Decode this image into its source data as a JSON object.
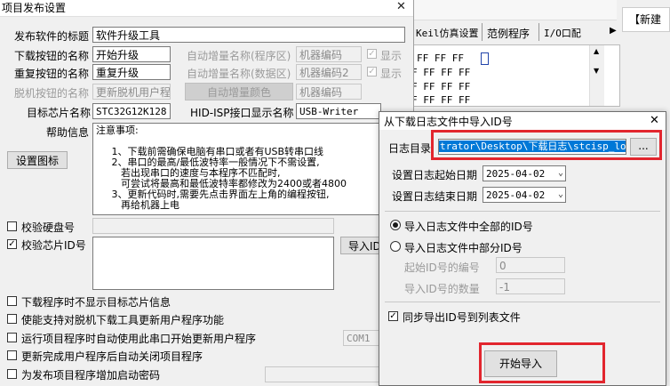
{
  "main_window": {
    "title": "项目发布设置",
    "fields": {
      "title_label": "发布软件的标题",
      "title_value": "软件升级工具",
      "download_btn_label": "下载按钮的名称",
      "download_btn_value": "开始升级",
      "repeat_btn_label": "重复按钮的名称",
      "repeat_btn_value": "重复升级",
      "offline_btn_label": "脱机按钮的名称",
      "offline_btn_value": "更新脱机用户程",
      "auto_inc_program_label": "自动增量名称(程序区)",
      "auto_inc_program_value": "机器编码",
      "auto_inc_data_label": "自动增量名称(数据区)",
      "auto_inc_data_value": "机器编码2",
      "auto_inc_color_button": "自动增量颜色",
      "auto_inc_color_value": "机器编码",
      "show_label": "显示",
      "show_label2": "显示",
      "target_chip_label": "目标芯片名称",
      "target_chip_value": "STC32G12K128",
      "hid_label": "HID-ISP接口显示名称",
      "hid_value": "USB-Writer",
      "help_label": "帮助信息",
      "set_icon_button": "设置图标",
      "help_text": "注意事项:\n\n     1、下载前需确保电脑有串口或者有USB转串口线\n     2、串口的最高/最低波特率一般情况下不需设置,\n        若出现串口的速度与本程序不匹配时,\n        可尝试将最高和最低波特率都修改为2400或者4800\n     3、更新代码时,需要先点击界面左上角的编程按钮,\n        再给机器上电"
    },
    "checkboxes": {
      "verify_disk": "校验硬盘号",
      "verify_chip": "校验芯片ID号",
      "import_id_button": "导入ID",
      "hide_target_info": "下载程序时不显示目标芯片信息",
      "support_offline": "使能支持对脱机下载工具更新用户程序功能",
      "auto_serial": "运行项目程序时自动使用此串口开始更新用户程序",
      "com_value": "COM1",
      "auto_close": "更新完成用户程序后自动关闭项目程序",
      "add_startup": "为发布项目程序增加启动密码"
    }
  },
  "background": {
    "tabs": [
      "Keil仿真设置",
      "范例程序",
      "I/O口配"
    ],
    "hex_rows": [
      "FF FF FF",
      "F FF FF FF",
      "F FF FF FF",
      "F FF FF FF"
    ],
    "right_label": "【新建"
  },
  "dialog": {
    "title": "从下载日志文件中导入ID号",
    "close_glyph": "✕",
    "log_dir_label": "日志目录",
    "log_dir_value": "trator\\Desktop\\下载日志\\stcisp_log",
    "browse_button": "...",
    "start_date_label": "设置日志起始日期",
    "start_date_value": "2025-04-02",
    "end_date_label": "设置日志结束日期",
    "end_date_value": "2025-04-02",
    "radio_all": "导入日志文件中全部的ID号",
    "radio_partial": "导入日志文件中部分ID号",
    "start_index_label": "起始ID号的编号",
    "start_index_value": "0",
    "count_label": "导入ID号的数量",
    "count_value": "-1",
    "sync_export": "同步导出ID号到列表文件",
    "start_import_button": "开始导入"
  },
  "colors": {
    "highlight": "#e2262e",
    "selection": "#0078d7"
  }
}
